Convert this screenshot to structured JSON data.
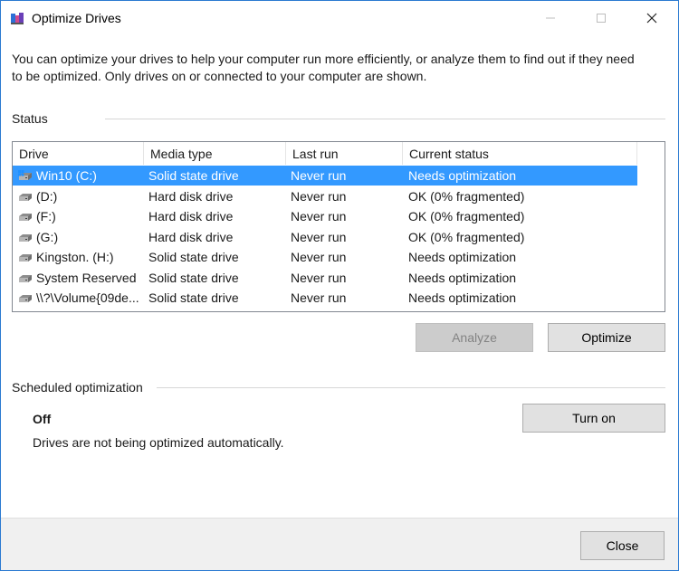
{
  "window": {
    "title": "Optimize Drives"
  },
  "intro": "You can optimize your drives to help your computer run more efficiently, or analyze them to find out if they need to be optimized. Only drives on or connected to your computer are shown.",
  "status": {
    "label": "Status",
    "columns": [
      "Drive",
      "Media type",
      "Last run",
      "Current status"
    ],
    "drives": [
      {
        "drive": "Win10 (C:)",
        "media": "Solid state drive",
        "last_run": "Never run",
        "status": "Needs optimization",
        "icon": "windows-drive-icon",
        "selected": true
      },
      {
        "drive": "(D:)",
        "media": "Hard disk drive",
        "last_run": "Never run",
        "status": "OK (0% fragmented)",
        "icon": "drive-icon",
        "selected": false
      },
      {
        "drive": "(F:)",
        "media": "Hard disk drive",
        "last_run": "Never run",
        "status": "OK (0% fragmented)",
        "icon": "drive-icon",
        "selected": false
      },
      {
        "drive": "(G:)",
        "media": "Hard disk drive",
        "last_run": "Never run",
        "status": "OK (0% fragmented)",
        "icon": "drive-icon",
        "selected": false
      },
      {
        "drive": "Kingston. (H:)",
        "media": "Solid state drive",
        "last_run": "Never run",
        "status": "Needs optimization",
        "icon": "drive-icon",
        "selected": false
      },
      {
        "drive": "System Reserved",
        "media": "Solid state drive",
        "last_run": "Never run",
        "status": "Needs optimization",
        "icon": "drive-icon",
        "selected": false
      },
      {
        "drive": "\\\\?\\Volume{09de...",
        "media": "Solid state drive",
        "last_run": "Never run",
        "status": "Needs optimization",
        "icon": "drive-icon",
        "selected": false
      }
    ],
    "analyze_label": "Analyze",
    "optimize_label": "Optimize"
  },
  "schedule": {
    "label": "Scheduled optimization",
    "state": "Off",
    "description": "Drives are not being optimized automatically.",
    "turn_on_label": "Turn on"
  },
  "footer": {
    "close_label": "Close"
  },
  "colors": {
    "selection": "#3399ff",
    "window_border": "#2b7ad1"
  }
}
